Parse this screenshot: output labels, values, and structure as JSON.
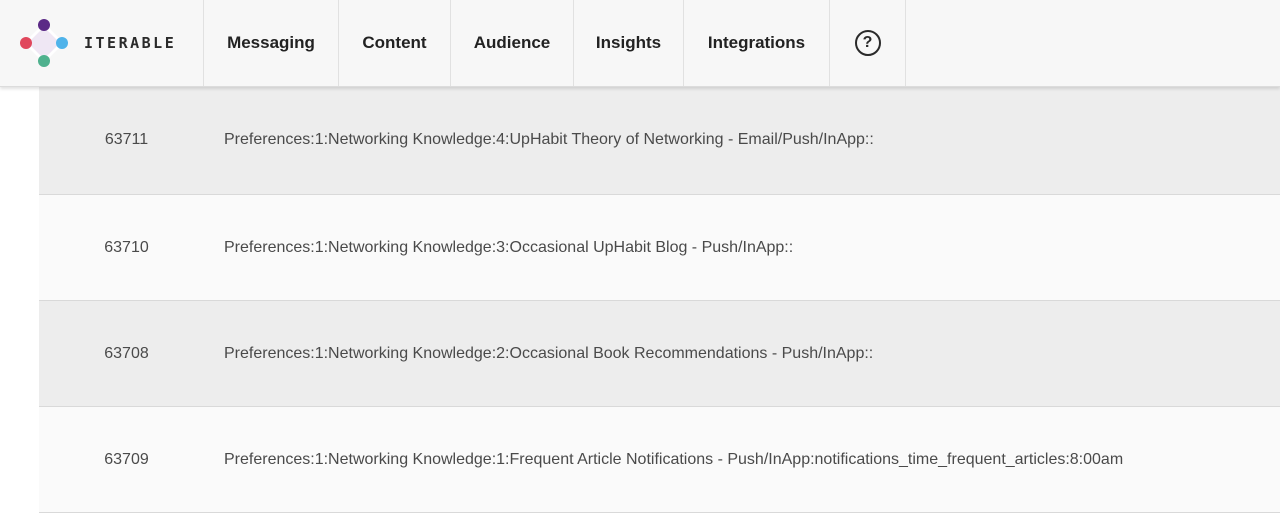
{
  "brand": {
    "name": "ITERABLE",
    "colors": [
      "#5b2a86",
      "#4fb3ea",
      "#4fb18e",
      "#e0475c"
    ]
  },
  "nav": {
    "items": [
      {
        "label": "Messaging"
      },
      {
        "label": "Content"
      },
      {
        "label": "Audience"
      },
      {
        "label": "Insights"
      },
      {
        "label": "Integrations"
      }
    ],
    "help_icon": "question-circle-icon",
    "help_glyph": "?"
  },
  "table": {
    "rows": [
      {
        "id": "63711",
        "name": "Preferences:1:Networking Knowledge:4:UpHabit Theory of Networking - Email/Push/InApp::"
      },
      {
        "id": "63710",
        "name": "Preferences:1:Networking Knowledge:3:Occasional UpHabit Blog - Push/InApp::"
      },
      {
        "id": "63708",
        "name": "Preferences:1:Networking Knowledge:2:Occasional Book Recommendations - Push/InApp::"
      },
      {
        "id": "63709",
        "name": "Preferences:1:Networking Knowledge:1:Frequent Article Notifications - Push/InApp:notifications_time_frequent_articles:8:00am"
      }
    ]
  }
}
